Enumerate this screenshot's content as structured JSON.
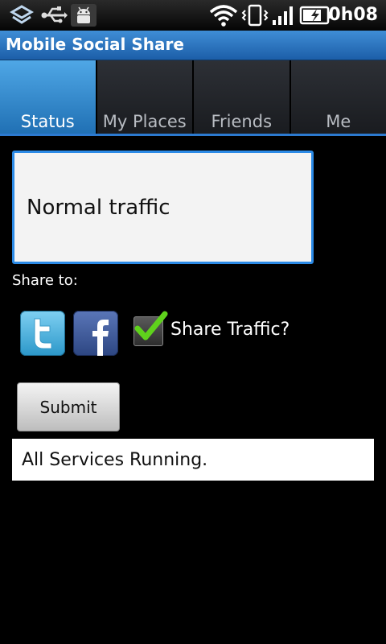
{
  "status_bar": {
    "time": "0h08",
    "icons": [
      "layers-icon",
      "usb-icon",
      "android-debug-icon",
      "wifi-icon",
      "vibrate-icon",
      "signal-icon",
      "battery-charging-icon"
    ]
  },
  "app": {
    "title": "Mobile Social Share"
  },
  "tabs": [
    {
      "label": "Status",
      "active": true
    },
    {
      "label": "My Places",
      "active": false
    },
    {
      "label": "Friends",
      "active": false
    },
    {
      "label": "Me",
      "active": false
    }
  ],
  "status_input": {
    "value": "Normal traffic"
  },
  "share": {
    "label": "Share to:",
    "services": [
      "twitter-icon",
      "facebook-icon"
    ],
    "share_traffic_label": "Share Traffic?",
    "share_traffic_checked": true
  },
  "submit_label": "Submit",
  "service_status": "All Services Running.",
  "colors": {
    "accent": "#2b8ae6",
    "title_bar": "#2b72c0",
    "active_tab": "#3a8fd6",
    "check": "#5fd21c"
  }
}
